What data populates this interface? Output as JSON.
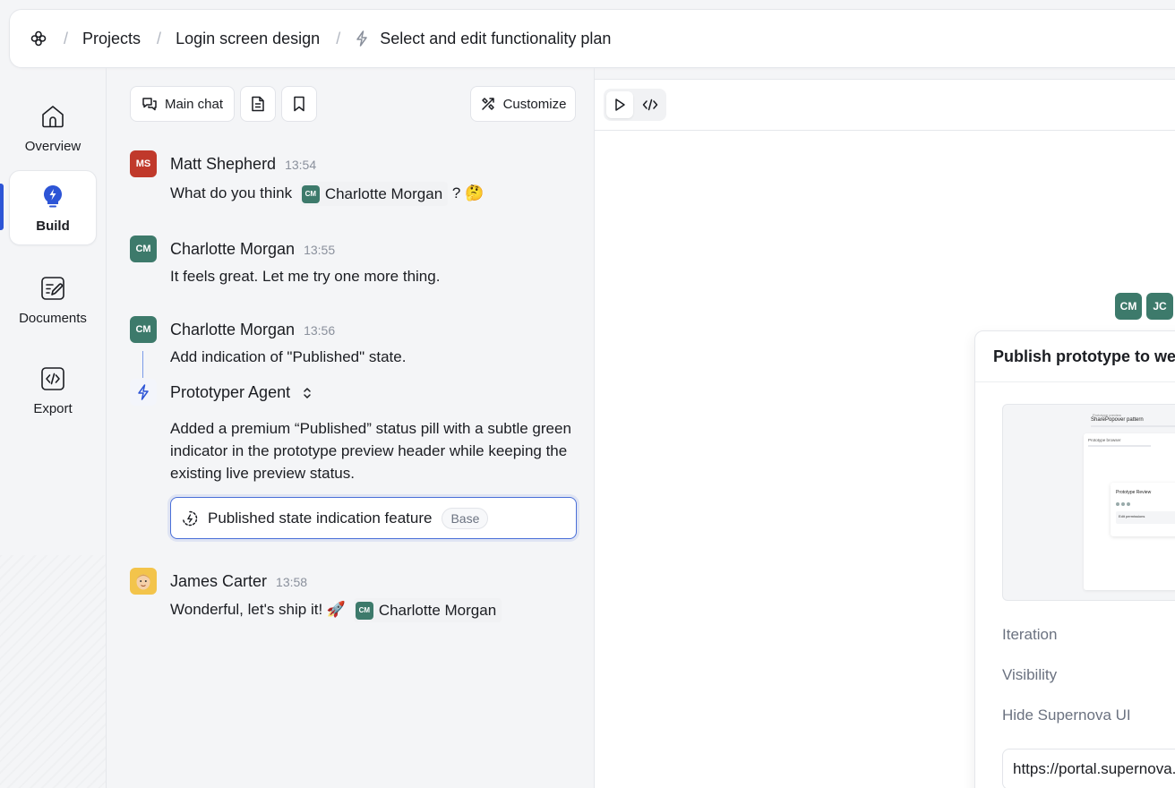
{
  "breadcrumb": {
    "items": [
      "Projects",
      "Login screen design",
      "Select and edit functionality plan"
    ],
    "separator": "/"
  },
  "sidebar": {
    "items": [
      {
        "label": "Overview",
        "icon": "home-icon",
        "active": false
      },
      {
        "label": "Build",
        "icon": "bolt-bulb-icon",
        "active": true
      },
      {
        "label": "Documents",
        "icon": "document-edit-icon",
        "active": false
      },
      {
        "label": "Export",
        "icon": "code-icon",
        "active": false
      }
    ]
  },
  "chat": {
    "toolbar": {
      "main_chat_label": "Main chat",
      "customize_label": "Customize"
    },
    "messages": [
      {
        "initials": "MS",
        "name": "Matt Shepherd",
        "time": "13:54",
        "text": "What do you think",
        "mention": {
          "initials": "CM",
          "name": "Charlotte Morgan"
        },
        "suffix": "?",
        "emoji": "🤔"
      },
      {
        "initials": "CM",
        "name": "Charlotte Morgan",
        "time": "13:55",
        "text": "It feels great. Let me try one more thing."
      },
      {
        "initials": "CM",
        "name": "Charlotte Morgan",
        "time": "13:56",
        "text": "Add indication of \"Published\" state."
      },
      {
        "name": "James Carter",
        "time": "13:58",
        "text": "Wonderful, let's ship it! 🚀",
        "mention": {
          "initials": "CM",
          "name": "Charlotte Morgan"
        }
      }
    ],
    "agent": {
      "name": "Prototyper Agent",
      "text": "Added a premium “Published” status pill with a subtle green indicator in the prototype preview header while keeping the existing live preview status.",
      "feature": {
        "title": "Published state indication feature",
        "badge": "Base"
      }
    }
  },
  "preview": {
    "collaborators": [
      "CM",
      "JC"
    ],
    "publish": {
      "title": "Publish prototype to web",
      "thumbnail": {
        "label": "Prototype preview",
        "heading": "SharePopover pattern",
        "section": "Prototype browser",
        "card_title": "Prototype Review",
        "permissions": "Edit permissions"
      },
      "fields": [
        "Iteration",
        "Visibility",
        "Hide Supernova UI"
      ],
      "url": "https://portal.supernova.io"
    }
  },
  "colors": {
    "accent": "#2d55d6",
    "avatar_ms": "#c0392b",
    "avatar_cm": "#3d7a6b",
    "avatar_jc": "#f3c44b"
  }
}
